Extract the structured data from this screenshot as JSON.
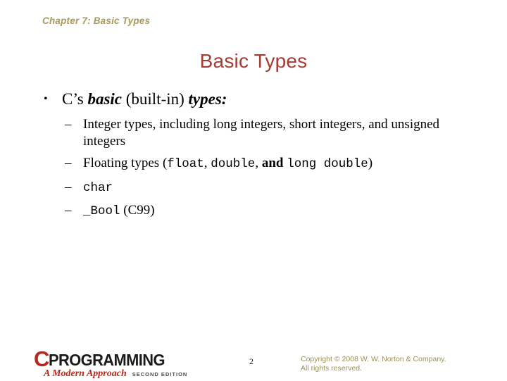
{
  "slide": {
    "chapter_header": "Chapter 7: Basic Types",
    "title": "Basic Types",
    "bullet": {
      "text_1": "C’s ",
      "emph_1": "basic",
      "text_2": " (built-in) ",
      "emph_2": "types:",
      "marker": "•"
    },
    "sub_bullets": [
      {
        "marker": "–",
        "parts": [
          {
            "style": "serif",
            "text": "Integer types, including long integers, short integers, and unsigned integers"
          }
        ]
      },
      {
        "marker": "–",
        "parts": [
          {
            "style": "serif",
            "text": "Floating types ("
          },
          {
            "style": "mono",
            "text": "float"
          },
          {
            "style": "serif",
            "text": ", "
          },
          {
            "style": "mono",
            "text": "double"
          },
          {
            "style": "serif",
            "text": ", "
          },
          {
            "style": "bold",
            "text": "and"
          },
          {
            "style": "serif",
            "text": " "
          },
          {
            "style": "mono",
            "text": "long double"
          },
          {
            "style": "serif",
            "text": ")"
          }
        ]
      },
      {
        "marker": "–",
        "parts": [
          {
            "style": "mono",
            "text": "char"
          }
        ]
      },
      {
        "marker": "–",
        "parts": [
          {
            "style": "mono",
            "text": "_Bool"
          },
          {
            "style": "serif",
            "text": " (C99)"
          }
        ]
      }
    ]
  },
  "footer": {
    "logo": {
      "letter": "C",
      "word": "PROGRAMMING",
      "subtitle": "A Modern Approach",
      "edition": "SECOND EDITION"
    },
    "page_number": "2",
    "copyright_line_1": "Copyright © 2008 W. W. Norton & Company.",
    "copyright_line_2": "All rights reserved."
  },
  "colors": {
    "header_gold": "#a89a5a",
    "title_red": "#a33c32",
    "logo_red": "#b9281f",
    "copyright_olive": "#9c8f55",
    "body_black": "#000000",
    "background": "#ffffff"
  }
}
